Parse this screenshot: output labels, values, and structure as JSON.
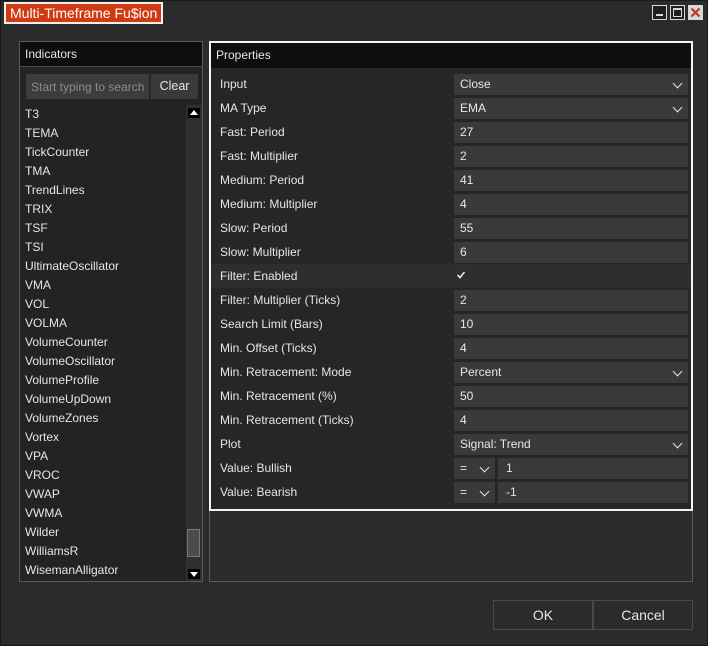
{
  "window": {
    "title": "Multi-Timeframe Fu$ion"
  },
  "indicators": {
    "header": "Indicators",
    "search_placeholder": "Start typing to search",
    "clear_label": "Clear",
    "items": [
      "T3",
      "TEMA",
      "TickCounter",
      "TMA",
      "TrendLines",
      "TRIX",
      "TSF",
      "TSI",
      "UltimateOscillator",
      "VMA",
      "VOL",
      "VOLMA",
      "VolumeCounter",
      "VolumeOscillator",
      "VolumeProfile",
      "VolumeUpDown",
      "VolumeZones",
      "Vortex",
      "VPA",
      "VROC",
      "VWAP",
      "VWMA",
      "Wilder",
      "WilliamsR",
      "WisemanAlligator"
    ]
  },
  "properties": {
    "header": "Properties",
    "rows": {
      "input": {
        "label": "Input",
        "value": "Close"
      },
      "ma_type": {
        "label": "MA Type",
        "value": "EMA"
      },
      "fast_period": {
        "label": "Fast: Period",
        "value": "27"
      },
      "fast_multiplier": {
        "label": "Fast: Multiplier",
        "value": "2"
      },
      "medium_period": {
        "label": "Medium: Period",
        "value": "41"
      },
      "medium_multiplier": {
        "label": "Medium: Multiplier",
        "value": "4"
      },
      "slow_period": {
        "label": "Slow: Period",
        "value": "55"
      },
      "slow_multiplier": {
        "label": "Slow: Multiplier",
        "value": "6"
      },
      "filter_enabled": {
        "label": "Filter: Enabled",
        "checked": true
      },
      "filter_multiplier": {
        "label": "Filter: Multiplier (Ticks)",
        "value": "2"
      },
      "search_limit": {
        "label": "Search Limit (Bars)",
        "value": "10"
      },
      "min_offset": {
        "label": "Min. Offset (Ticks)",
        "value": "4"
      },
      "min_retracement_mode": {
        "label": "Min. Retracement: Mode",
        "value": "Percent"
      },
      "min_retracement_pct": {
        "label": "Min. Retracement (%)",
        "value": "50"
      },
      "min_retracement_ticks": {
        "label": "Min. Retracement (Ticks)",
        "value": "4"
      },
      "plot": {
        "label": "Plot",
        "value": "Signal: Trend"
      },
      "value_bullish": {
        "label": "Value: Bullish",
        "operator": "=",
        "value": "1"
      },
      "value_bearish": {
        "label": "Value: Bearish",
        "operator": "=",
        "value": "-1"
      }
    }
  },
  "buttons": {
    "ok_label": "OK",
    "cancel_label": "Cancel"
  }
}
